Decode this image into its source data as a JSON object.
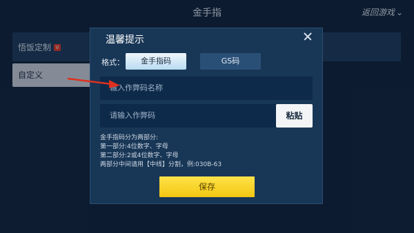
{
  "background": {
    "title": "金手指",
    "back_label": "返回游戏",
    "items": [
      {
        "label": "悟饭定制",
        "badge": "V"
      },
      {
        "label": "自定义",
        "arrow": ">"
      }
    ]
  },
  "dialog": {
    "title": "温馨提示",
    "format_label": "格式：",
    "formats": [
      "金手指码",
      "GS码"
    ],
    "selected_format": "金手指码",
    "name_input": {
      "placeholder": "输入作弊码名称",
      "value": ""
    },
    "code_input": {
      "placeholder": "请输入作弊码",
      "value": ""
    },
    "paste_label": "粘贴",
    "help_lines": [
      "金手指码分为两部分:",
      "第一部分:4位数字、字母",
      "第二部分:2或4位数字、字母",
      "两部分中间请用【中线】分割，例:030B-63"
    ],
    "save_label": "保存"
  },
  "colors": {
    "dialog_bg": "#183656",
    "accent_yellow": "#f3c712",
    "arrow_red": "#e0311f"
  }
}
